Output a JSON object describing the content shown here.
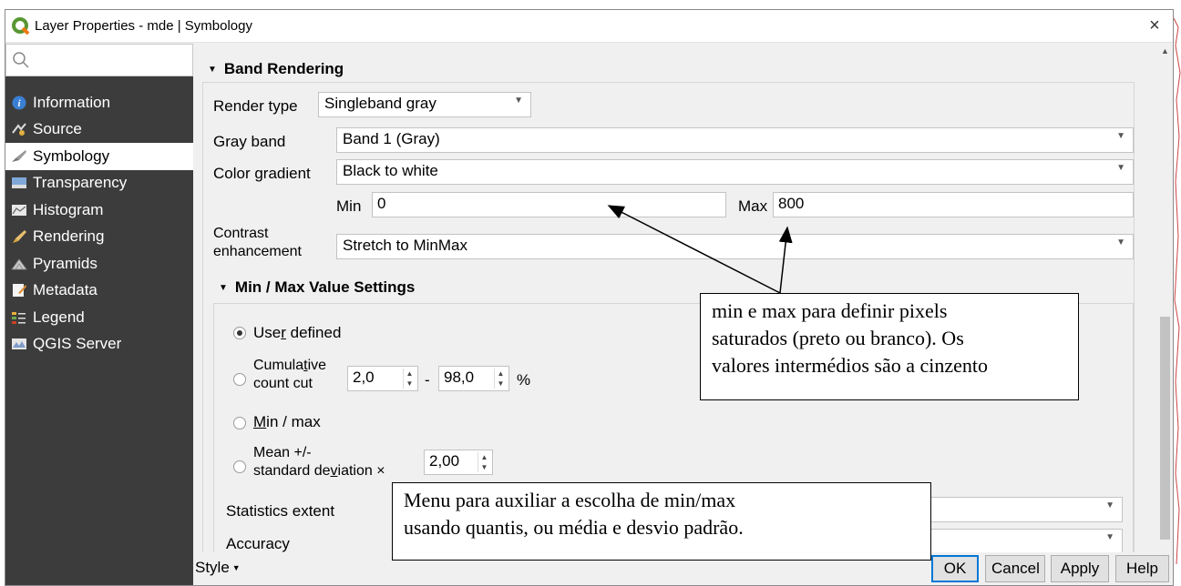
{
  "window": {
    "title": "Layer Properties - mde | Symbology",
    "close_glyph": "×"
  },
  "sidebar": {
    "items": [
      {
        "label": "Information",
        "icon": "info-icon"
      },
      {
        "label": "Source",
        "icon": "source-icon"
      },
      {
        "label": "Symbology",
        "icon": "symbology-icon",
        "active": true
      },
      {
        "label": "Transparency",
        "icon": "transparency-icon"
      },
      {
        "label": "Histogram",
        "icon": "histogram-icon"
      },
      {
        "label": "Rendering",
        "icon": "rendering-icon"
      },
      {
        "label": "Pyramids",
        "icon": "pyramids-icon"
      },
      {
        "label": "Metadata",
        "icon": "metadata-icon"
      },
      {
        "label": "Legend",
        "icon": "legend-icon"
      },
      {
        "label": "QGIS Server",
        "icon": "qgis-server-icon"
      }
    ]
  },
  "band_rendering": {
    "header": "Band Rendering",
    "render_type_label": "Render type",
    "render_type_value": "Singleband gray",
    "gray_band_label": "Gray band",
    "gray_band_value": "Band 1 (Gray)",
    "color_gradient_label": "Color gradient",
    "color_gradient_value": "Black to white",
    "min_label": "Min",
    "min_value": "0",
    "max_label": "Max",
    "max_value": "800",
    "contrast_label_line1": "Contrast",
    "contrast_label_line2": "enhancement",
    "contrast_value": "Stretch to MinMax"
  },
  "minmax": {
    "header": "Min / Max Value Settings",
    "user_defined_pre": "Use",
    "user_defined_u": "r",
    "user_defined_post": " defined",
    "cumulative_line1_pre": "Cumula",
    "cumulative_line1_u": "t",
    "cumulative_line1_post": "ive",
    "cumulative_line2": "count cut",
    "cum_low": "2,0",
    "dash": "-",
    "cum_high": "98,0",
    "percent": "%",
    "minmax_u": "M",
    "minmax_post": "in / max",
    "mean_line1": "Mean +/-",
    "mean_line2_pre": "standard de",
    "mean_line2_u": "v",
    "mean_line2_post": "iation ×",
    "mean_value": "2,00",
    "statistics_extent_label": "Statistics extent",
    "accuracy_label": "Accuracy"
  },
  "buttons": {
    "style": "Style",
    "ok": "OK",
    "cancel": "Cancel",
    "apply": "Apply",
    "help": "Help"
  },
  "annotations": {
    "callout1_line1": "min e max para definir pixels",
    "callout1_line2": "saturados (preto ou branco). Os",
    "callout1_line3": "valores intermédios são a cinzento",
    "callout2_line1": "Menu para auxiliar a escolha de  min/max",
    "callout2_line2": "usando quantis, ou média e desvio padrão."
  },
  "colors": {
    "sidebar_bg": "#3c3c3c",
    "accent": "#0078d7",
    "qgis_green": "#589632"
  }
}
